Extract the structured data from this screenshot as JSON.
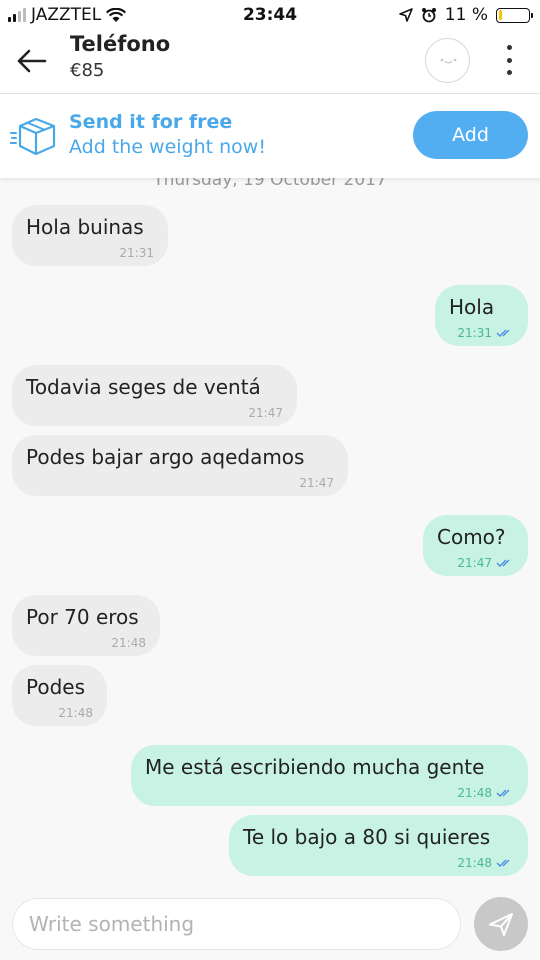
{
  "status_bar": {
    "carrier": "JAZZTEL",
    "time": "23:44",
    "battery_percent": "11 %",
    "battery_level": 0.11
  },
  "header": {
    "title": "Teléfono",
    "price": "€85",
    "icons": [
      "back-arrow-icon",
      "avatar",
      "more-vertical-icon"
    ]
  },
  "banner": {
    "title": "Send it for free",
    "subtitle": "Add the weight now!",
    "button_label": "Add",
    "accent_color": "#4aa8e8",
    "icon": "box-icon"
  },
  "chat": {
    "date_separator": "Thursday, 19 October 2017",
    "messages": [
      {
        "direction": "in",
        "text": "Hola buinas",
        "time": "21:31"
      },
      {
        "direction": "out",
        "text": "Hola",
        "time": "21:31",
        "read": true
      },
      {
        "direction": "in",
        "text": "Todavia seges de ventá",
        "time": "21:47"
      },
      {
        "direction": "in",
        "text": "Podes bajar argo aqedamos",
        "time": "21:47"
      },
      {
        "direction": "out",
        "text": "Como?",
        "time": "21:47",
        "read": true
      },
      {
        "direction": "in",
        "text": "Por 70 eros",
        "time": "21:48"
      },
      {
        "direction": "in",
        "text": "Podes",
        "time": "21:48"
      },
      {
        "direction": "out",
        "text": "Me está escribiendo mucha gente",
        "time": "21:48",
        "read": true
      },
      {
        "direction": "out",
        "text": "Te lo bajo a 80 si quieres",
        "time": "21:48",
        "read": true
      }
    ],
    "colors": {
      "incoming": "#ececec",
      "outgoing": "#c7f2e4",
      "ticks": "#4b8ee8"
    }
  },
  "composer": {
    "placeholder": "Write something",
    "value": "",
    "send_icon": "send-icon"
  }
}
